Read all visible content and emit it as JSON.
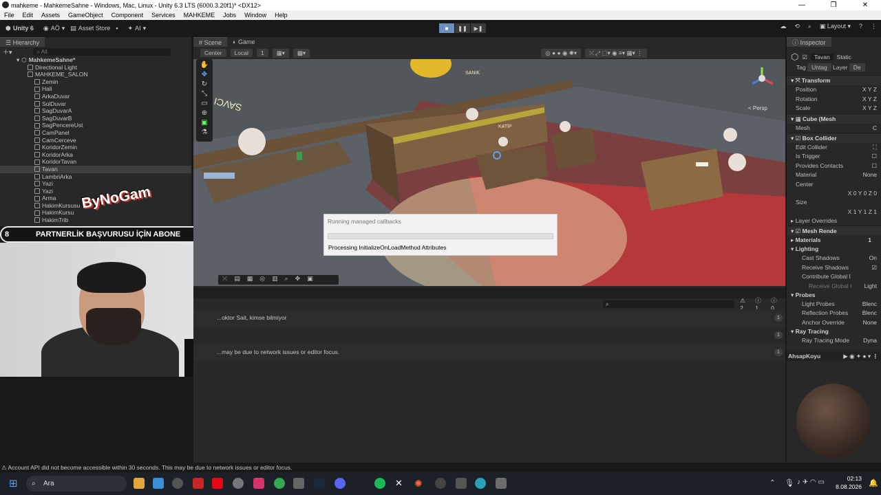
{
  "window": {
    "title": "mahkeme - MahkemeSahne - Windows, Mac, Linux - Unity 6.3 LTS (6000.3.20f1)* <DX12>",
    "controls": [
      "—",
      "❐",
      "✕"
    ]
  },
  "menu": [
    "File",
    "Edit",
    "Assets",
    "GameObject",
    "Component",
    "Services",
    "MAHKEME",
    "Jobs",
    "Window",
    "Help"
  ],
  "toolbar": {
    "unity_label": "Unity 6",
    "account": "AÖ",
    "asset_store": "Asset Store",
    "ai": "AI",
    "layout": "Layout"
  },
  "hierarchy": {
    "tab": "Hierarchy",
    "search_placeholder": "All",
    "scene": "MahkemeSahne*",
    "items": [
      {
        "label": "Directional Light",
        "indent": 1
      },
      {
        "label": "MAHKEME_SALON",
        "indent": 1
      },
      {
        "label": "Zemin",
        "indent": 2
      },
      {
        "label": "Hali",
        "indent": 2
      },
      {
        "label": "ArkaDuvar",
        "indent": 2
      },
      {
        "label": "SolDuvar",
        "indent": 2
      },
      {
        "label": "SagDuvarA",
        "indent": 2
      },
      {
        "label": "SagDuvarB",
        "indent": 2
      },
      {
        "label": "SagPencereUst",
        "indent": 2
      },
      {
        "label": "CamPanel",
        "indent": 2
      },
      {
        "label": "CamCerceve",
        "indent": 2
      },
      {
        "label": "KoridorZemin",
        "indent": 2
      },
      {
        "label": "KoridorArka",
        "indent": 2
      },
      {
        "label": "KoridorTavan",
        "indent": 2
      },
      {
        "label": "Tavan",
        "indent": 2,
        "selected": true
      },
      {
        "label": "LambriArka",
        "indent": 2
      },
      {
        "label": "Yazi",
        "indent": 2
      },
      {
        "label": "Yazi",
        "indent": 2
      },
      {
        "label": "Arma",
        "indent": 2
      },
      {
        "label": "HakimKursusu",
        "indent": 2
      },
      {
        "label": "HakimKursu",
        "indent": 2
      },
      {
        "label": "HakimTrib",
        "indent": 2
      }
    ]
  },
  "scene": {
    "tabs": [
      "Scene",
      "Game"
    ],
    "pivot": "Center",
    "space": "Local",
    "snap": "1",
    "persp": "< Persp",
    "labels": {
      "savci": "SAVCI",
      "avukat": "AVUKAT",
      "katip": "KATİP",
      "sanik": "SANIK"
    }
  },
  "dialog": {
    "title": "Running managed callbacks",
    "message": "Processing InitializeOnLoadMethod Attributes",
    "progress": 0
  },
  "console": {
    "counts": {
      "warnings": "2",
      "errors": "1",
      "info": "0"
    },
    "logs": [
      {
        "text": "...oktor Sait, kimse bilmiyor",
        "count": "1"
      },
      {
        "text": "",
        "count": "1"
      },
      {
        "text": "...may be due to network issues or editor focus.",
        "count": "1"
      }
    ]
  },
  "inspector": {
    "tab": "Inspector",
    "object_name": "Tavan",
    "static_label": "Static",
    "tag_label": "Tag",
    "tag_value": "Untag",
    "layer_label": "Layer",
    "layer_value": "De",
    "transform": "Transform",
    "position": "Position",
    "rotation": "Rotation",
    "scale": "Scale",
    "xyz": "X   Y   Z",
    "cube_mesh": "Cube (Mesh",
    "mesh_label": "Mesh",
    "mesh_value": "C",
    "box_collider": "Box Collider",
    "edit_collider": "Edit Collider",
    "is_trigger": "Is Trigger",
    "provides_contacts": "Provides Contacts",
    "material": "Material",
    "material_value": "None",
    "center": "Center",
    "center_vals": "X 0    Y 0    Z 0",
    "size": "Size",
    "size_vals": "X 1    Y 1    Z 1",
    "layer_overrides": "Layer Overrides",
    "mesh_renderer": "Mesh Rende",
    "materials": "Materials",
    "materials_count": "1",
    "lighting": "Lighting",
    "cast_shadows": "Cast Shadows",
    "cast_shadows_value": "On",
    "receive_shadows": "Receive Shadows",
    "contribute_gi": "Contribute Global I",
    "receive_gi": "Receive Global I",
    "receive_gi_value": "Light",
    "probes": "Probes",
    "light_probes": "Light Probes",
    "light_probes_value": "Blenc",
    "reflection_probes": "Reflection Probes",
    "reflection_probes_value": "Blenc",
    "anchor_override": "Anchor Override",
    "anchor_value": "None",
    "ray_tracing": "Ray Tracing",
    "ray_tracing_mode": "Ray Tracing Mode",
    "ray_tracing_value": "Dyna",
    "material_preview": "AhsapKoyu"
  },
  "overlay": {
    "left_num": "8",
    "text": "PARTNERLİK BAŞVURUSU İÇİN ABONE",
    "right_num": "25",
    "logo": "ByNoGam"
  },
  "status": "⚠ Account API did not become accessible within 30 seconds. This may be due to network issues or editor focus.",
  "taskbar": {
    "search": "Ara",
    "time": "02:13",
    "date": "8.08.2026"
  }
}
